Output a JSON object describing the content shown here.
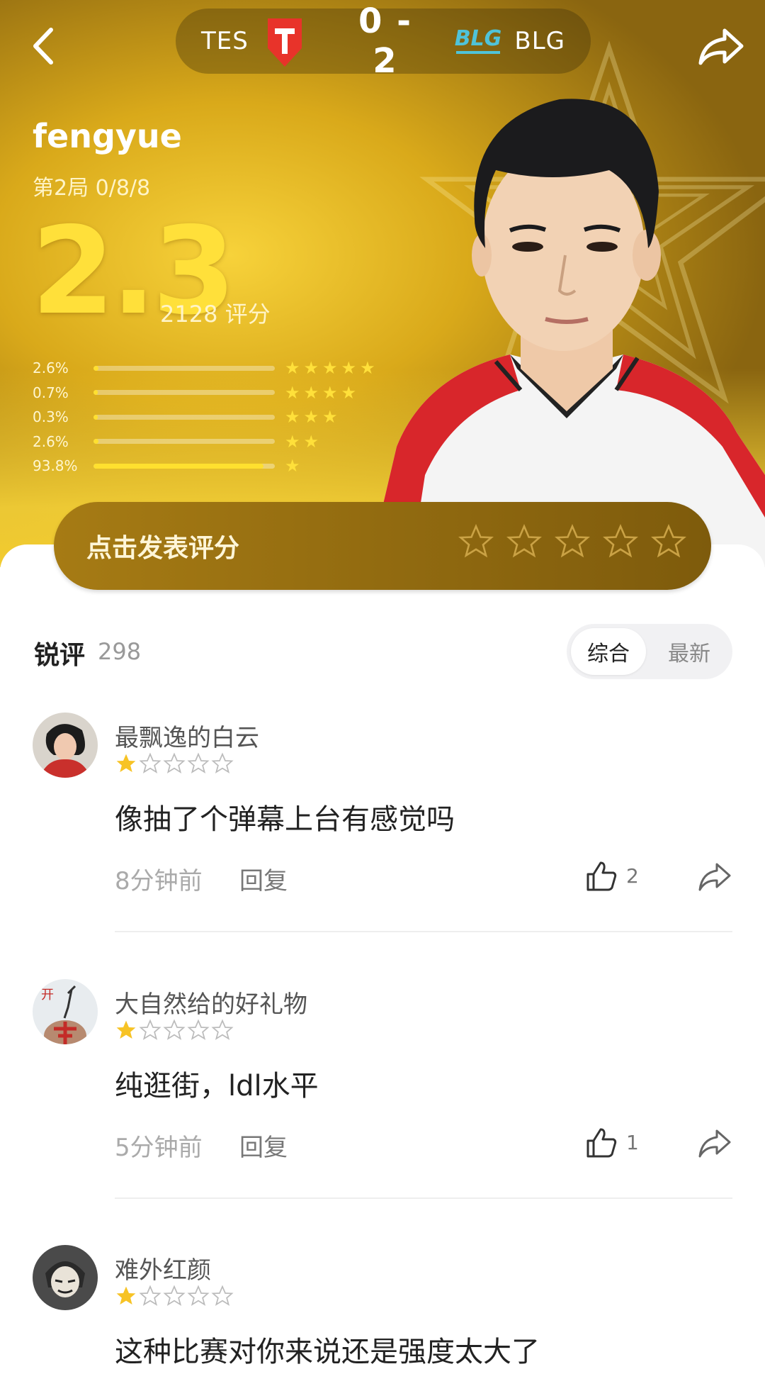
{
  "match": {
    "team_a": "TES",
    "team_b": "BLG",
    "score": "0 - 2",
    "team_b_logo_text": "BLG"
  },
  "player": {
    "name": "fengyue",
    "game_line": "第2局 0/8/8",
    "rating": "2.3",
    "rating_count": "2128 评分"
  },
  "distribution": [
    {
      "pct": "2.6%",
      "fraction": 0.026,
      "stars": "★★★★★"
    },
    {
      "pct": "0.7%",
      "fraction": 0.007,
      "stars": "★★★★"
    },
    {
      "pct": "0.3%",
      "fraction": 0.003,
      "stars": "★★★"
    },
    {
      "pct": "2.6%",
      "fraction": 0.026,
      "stars": "★★"
    },
    {
      "pct": "93.8%",
      "fraction": 0.938,
      "stars": "★"
    }
  ],
  "rate_button": {
    "label": "点击发表评分"
  },
  "reviews_header": {
    "title": "锐评",
    "count": "298",
    "tab_active": "综合",
    "tab_inactive": "最新"
  },
  "comments": [
    {
      "user": "最飘逸的白云",
      "stars": 1,
      "text": "像抽了个弹幕上台有感觉吗",
      "time": "8分钟前",
      "reply": "回复",
      "likes": "2"
    },
    {
      "user": "大自然给的好礼物",
      "stars": 1,
      "text": "纯逛街，ldl水平",
      "time": "5分钟前",
      "reply": "回复",
      "likes": "1"
    },
    {
      "user": "难外红颜",
      "stars": 1,
      "text": "这种比赛对你来说还是强度太大了",
      "time": "",
      "reply": "",
      "likes": ""
    }
  ],
  "colors": {
    "accent_gold": "#ffe03a",
    "button_gold": "#a67b14",
    "tes_red": "#e8332a",
    "blg_cyan": "#4fc3d9"
  },
  "icons": [
    "back-arrow-icon",
    "share-icon",
    "tes-logo-icon",
    "blg-logo-icon",
    "star-icon",
    "thumbs-up-icon",
    "share-arrow-icon"
  ]
}
